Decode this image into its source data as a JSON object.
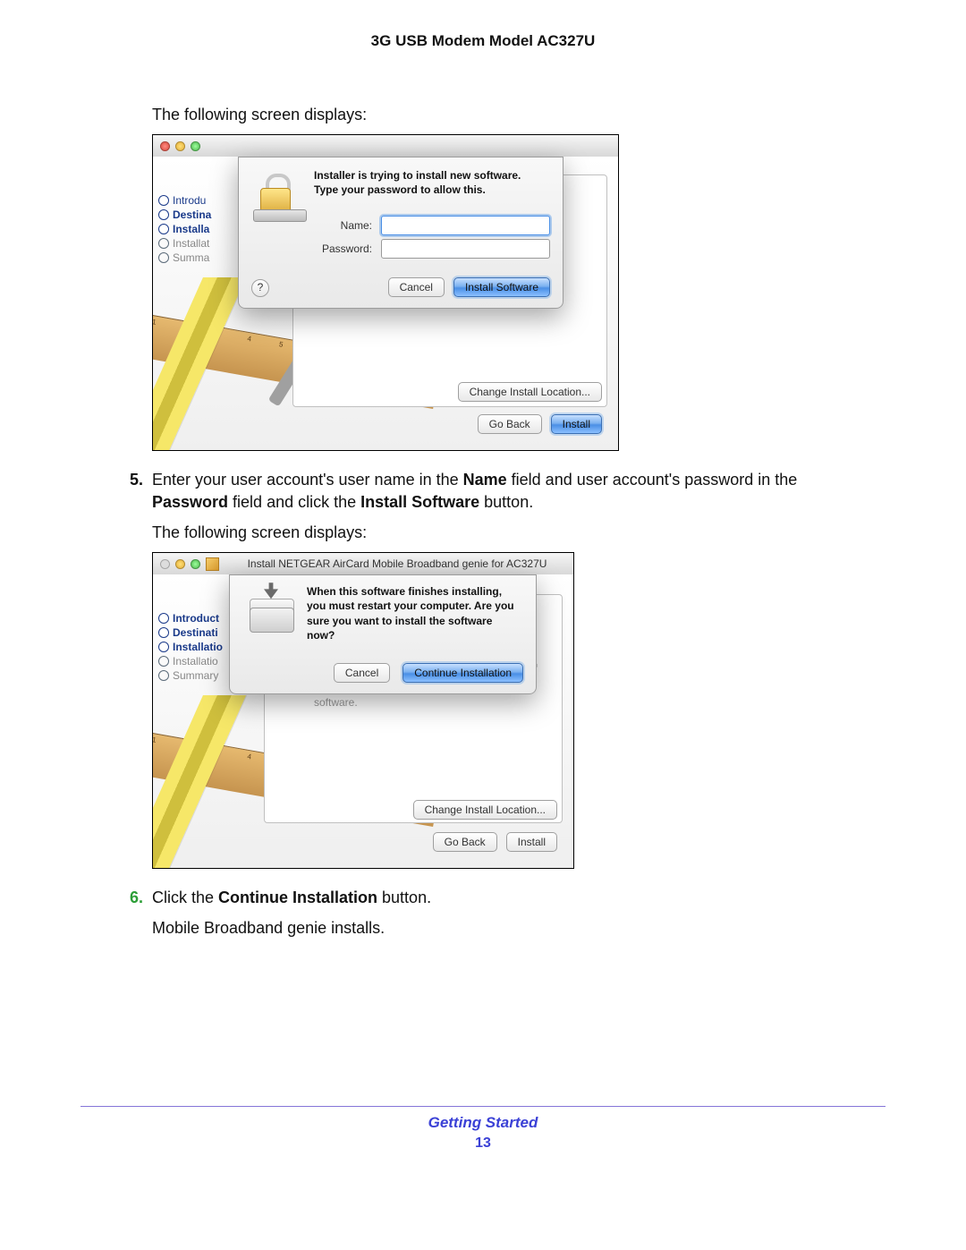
{
  "header": {
    "title": "3G USB Modem Model AC327U"
  },
  "intro1": "The following screen displays:",
  "intro2": "The following screen displays:",
  "step5": {
    "num": "5.",
    "text_1": "Enter your user account's user name in the ",
    "b1": "Name",
    "text_2": " field and user account's password in the ",
    "b2": "Password",
    "text_3": " field and click the ",
    "b3": "Install Software",
    "text_4": " button."
  },
  "step6": {
    "num": "6.",
    "text_1": "Click the ",
    "b1": "Continue Installation",
    "text_2": " button."
  },
  "post6": "Mobile Broadband genie installs.",
  "footer": {
    "section": "Getting Started",
    "page": "13"
  },
  "shot1": {
    "sidebar": [
      "Introdu",
      "Destina",
      "Installa",
      "Installat",
      "Summa"
    ],
    "dialog": {
      "line1": "Installer is trying to install new software.",
      "line2": "Type your password to allow this.",
      "name_lbl": "Name:",
      "pass_lbl": "Password:",
      "help": "?",
      "cancel": "Cancel",
      "install": "Install Software"
    },
    "change_loc": "Change Install Location...",
    "go_back": "Go Back",
    "install": "Install"
  },
  "shot2": {
    "wtitle": "Install NETGEAR AirCard Mobile Broadband genie for AC327U",
    "sidebar": [
      "Introduct",
      "Destinati",
      "Installatio",
      "Installatio",
      "Summary"
    ],
    "dialog": {
      "line1": "When this software finishes installing,",
      "line2": "you must restart your computer. Are you",
      "line3": "sure you want to install the software",
      "line4": "now?",
      "cancel": "Cancel",
      "cont": "Continue Installation"
    },
    "faded_of": "of",
    "faded_sw": "software.",
    "change_loc": "Change Install Location...",
    "go_back": "Go Back",
    "install": "Install"
  }
}
